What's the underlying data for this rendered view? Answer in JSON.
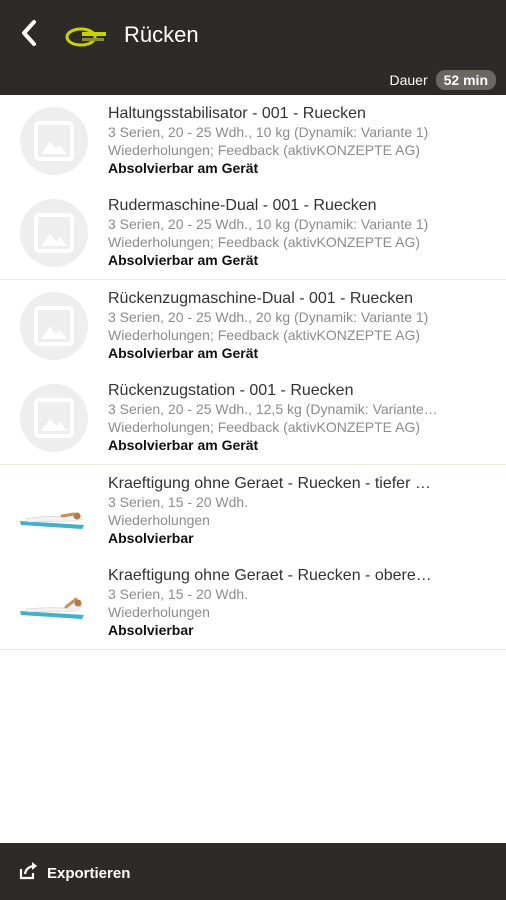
{
  "header": {
    "title": "Rücken",
    "duration_label": "Dauer",
    "duration_value": "52 min",
    "back_icon": "chevron-left-icon",
    "logo_icon": "brand-logo-icon"
  },
  "groups": [
    {
      "items": [
        {
          "name": "Haltungsstabilisator - 001 - Ruecken",
          "meta1": "3 Serien, 20 - 25 Wdh., 10 kg (Dynamik: Variante 1)",
          "meta2": "Wiederholungen; Feedback (aktivKONZEPTE AG)",
          "status": "Absolvierbar am Gerät",
          "thumb": "image-placeholder-icon"
        },
        {
          "name": "Rudermaschine-Dual - 001 - Ruecken",
          "meta1": "3 Serien, 20 - 25 Wdh., 10 kg (Dynamik: Variante 1)",
          "meta2": "Wiederholungen; Feedback (aktivKONZEPTE AG)",
          "status": "Absolvierbar am Gerät",
          "thumb": "image-placeholder-icon"
        }
      ]
    },
    {
      "items": [
        {
          "name": "Rückenzugmaschine-Dual - 001 - Ruecken",
          "meta1": "3 Serien, 20 - 25 Wdh., 20 kg (Dynamik: Variante 1)",
          "meta2": "Wiederholungen; Feedback (aktivKONZEPTE AG)",
          "status": "Absolvierbar am Gerät",
          "thumb": "image-placeholder-icon"
        },
        {
          "name": "Rückenzugstation - 001 - Ruecken",
          "meta1": "3 Serien, 20 - 25 Wdh., 12,5 kg (Dynamik: Variante…",
          "meta2": "Wiederholungen; Feedback (aktivKONZEPTE AG)",
          "status": "Absolvierbar am Gerät",
          "thumb": "image-placeholder-icon"
        }
      ]
    },
    {
      "items": [
        {
          "name": "Kraeftigung ohne Geraet - Ruecken - tiefer …",
          "meta1": "3 Serien, 15 - 20 Wdh.",
          "meta2": "Wiederholungen",
          "status": "Absolvierbar",
          "thumb": "exercise-photo-icon"
        },
        {
          "name": "Kraeftigung ohne Geraet - Ruecken - obere…",
          "meta1": "3 Serien, 15 - 20 Wdh.",
          "meta2": "Wiederholungen",
          "status": "Absolvierbar",
          "thumb": "exercise-photo-icon"
        }
      ]
    }
  ],
  "footer": {
    "export_label": "Exportieren",
    "export_icon": "share-export-icon"
  },
  "colors": {
    "bar": "#2e2a27",
    "badge": "#6a6662",
    "logo_accent": "#c8d400",
    "mat": "#3fb2c8"
  }
}
